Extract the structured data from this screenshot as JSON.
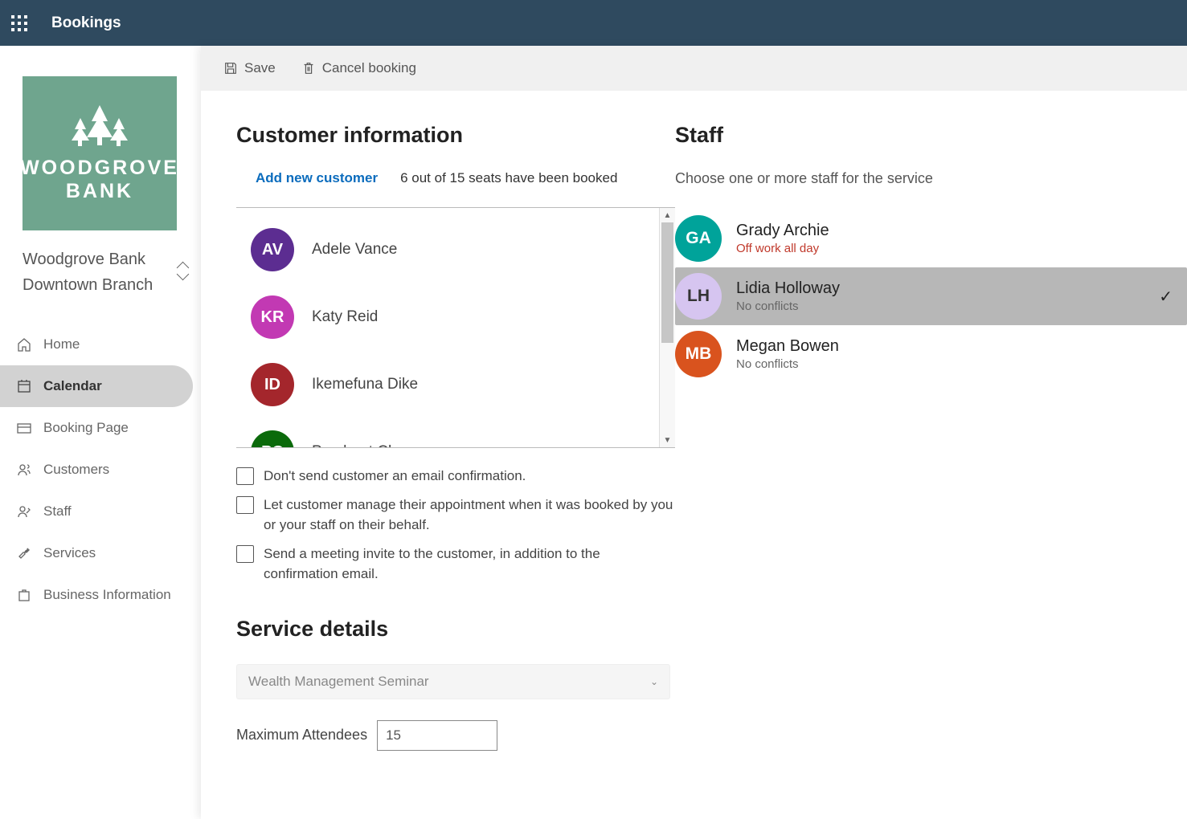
{
  "app_title": "Bookings",
  "business": {
    "logoText1": "WOODGROVE",
    "logoText2": "BANK",
    "line1": "Woodgrove Bank",
    "line2": "Downtown Branch"
  },
  "nav": [
    {
      "id": "home",
      "label": "Home"
    },
    {
      "id": "calendar",
      "label": "Calendar"
    },
    {
      "id": "booking-page",
      "label": "Booking Page"
    },
    {
      "id": "customers",
      "label": "Customers"
    },
    {
      "id": "staff",
      "label": "Staff"
    },
    {
      "id": "services",
      "label": "Services"
    },
    {
      "id": "business-info",
      "label": "Business Information"
    }
  ],
  "nav_active": "calendar",
  "toolbar": {
    "save": "Save",
    "cancel": "Cancel booking"
  },
  "section_customer_title": "Customer information",
  "add_customer_link": "Add new customer",
  "seat_status": "6 out of 15 seats have been booked",
  "customers": [
    {
      "initials": "AV",
      "name": "Adele Vance",
      "color": "#5c2d91"
    },
    {
      "initials": "KR",
      "name": "Katy Reid",
      "color": "#c239b3"
    },
    {
      "initials": "ID",
      "name": "Ikemefuna Dike",
      "color": "#a4262c"
    },
    {
      "initials": "PC",
      "name": "Prashant Chourey",
      "color": "#0b6a0b"
    }
  ],
  "check_options": {
    "no_email": "Don't send customer an email confirmation.",
    "let_manage": "Let customer manage their appointment when it was booked by you or your staff on their behalf.",
    "send_invite": "Send a meeting invite to the customer, in addition to the confirmation email."
  },
  "service_section_title": "Service details",
  "service_selected": "Wealth Management Seminar",
  "max_attendees_label": "Maximum Attendees",
  "max_attendees_value": "15",
  "staff_title": "Staff",
  "staff_subtext": "Choose one or more staff for the service",
  "staff": [
    {
      "initials": "GA",
      "name": "Grady Archie",
      "status": "Off work all day",
      "warn": true,
      "color": "#00a39a",
      "textcolor": "#fff",
      "selected": false
    },
    {
      "initials": "LH",
      "name": "Lidia Holloway",
      "status": "No conflicts",
      "warn": false,
      "color": "#d6c5f0",
      "textcolor": "#333",
      "selected": true
    },
    {
      "initials": "MB",
      "name": "Megan Bowen",
      "status": "No conflicts",
      "warn": false,
      "color": "#d9531e",
      "textcolor": "#fff",
      "selected": false
    }
  ]
}
